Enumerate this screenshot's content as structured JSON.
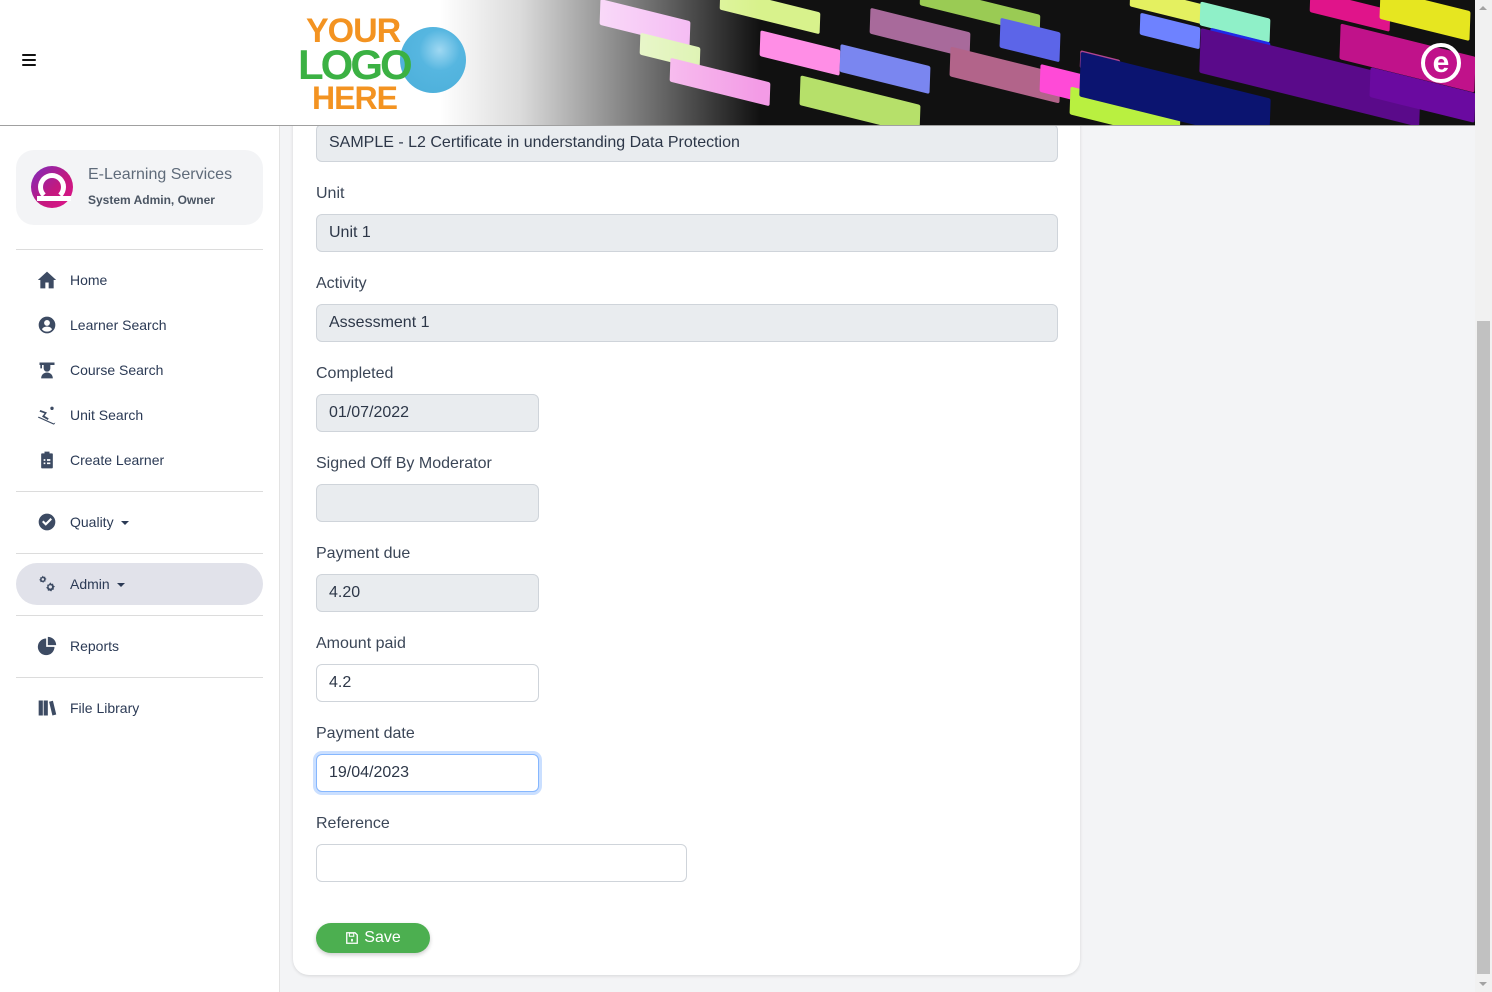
{
  "header": {
    "menu_icon": "hamburger-icon",
    "logo": {
      "line1": "YOUR",
      "line2": "LOGO",
      "line3": "HERE"
    },
    "brand_icon": "e-brand-icon",
    "brand_letter": "e"
  },
  "sidebar": {
    "profile": {
      "name": "E-Learning Services",
      "role": "System Admin, Owner",
      "logo_icon": "e-brand-icon"
    },
    "items": [
      {
        "label": "Home",
        "icon": "home-icon"
      },
      {
        "label": "Learner Search",
        "icon": "user-circle-icon"
      },
      {
        "label": "Course Search",
        "icon": "graduate-icon"
      },
      {
        "label": "Unit Search",
        "icon": "skiing-icon"
      },
      {
        "label": "Create Learner",
        "icon": "clipboard-list-icon"
      },
      {
        "label": "Quality",
        "icon": "check-circle-icon",
        "dropdown": true
      },
      {
        "label": "Admin",
        "icon": "cogs-icon",
        "dropdown": true,
        "active": true
      },
      {
        "label": "Reports",
        "icon": "pie-chart-icon"
      },
      {
        "label": "File Library",
        "icon": "book-library-icon"
      }
    ]
  },
  "form": {
    "course": {
      "value": "SAMPLE - L2 Certificate in understanding Data Protection",
      "readonly": true
    },
    "unit": {
      "label": "Unit",
      "value": "Unit 1",
      "readonly": true
    },
    "activity": {
      "label": "Activity",
      "value": "Assessment 1",
      "readonly": true
    },
    "completed": {
      "label": "Completed",
      "value": "01/07/2022",
      "readonly": true
    },
    "signed_off": {
      "label": "Signed Off By Moderator",
      "value": "",
      "readonly": true
    },
    "payment_due": {
      "label": "Payment due",
      "value": "4.20",
      "readonly": true
    },
    "amount_paid": {
      "label": "Amount paid",
      "value": "4.2"
    },
    "payment_date": {
      "label": "Payment date",
      "value": "19/04/2023"
    },
    "reference": {
      "label": "Reference",
      "value": ""
    },
    "save_label": "Save",
    "save_icon": "floppy-disk-icon"
  },
  "colors": {
    "save_button": "#4caf50",
    "focus_ring": "#86b7fe",
    "nav_text": "#2b3a55",
    "active_nav_bg": "#e1e2ea",
    "brand_gradient_start": "#7b2cbf",
    "brand_gradient_end": "#e0148a"
  }
}
